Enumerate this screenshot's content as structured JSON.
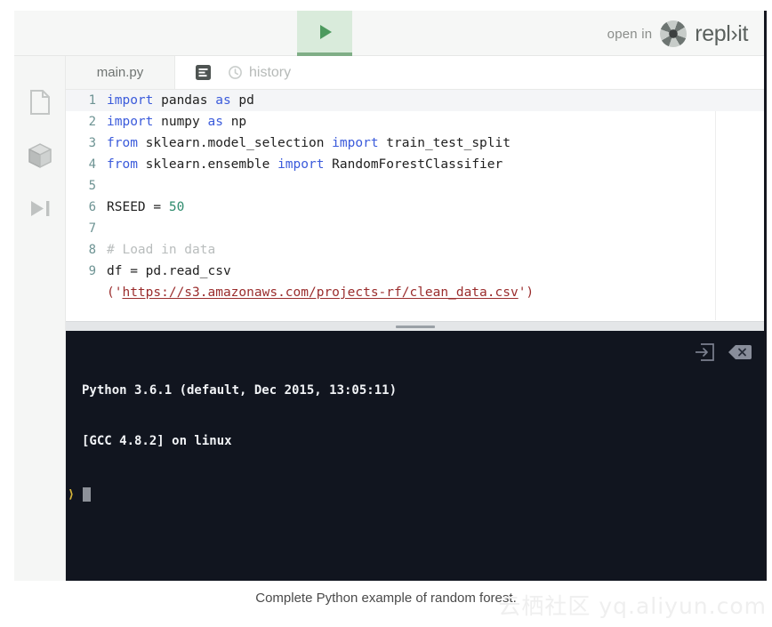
{
  "header": {
    "run_button_icon": "play-icon",
    "open_in_label": "open in",
    "repl_wordmark": "repl›it"
  },
  "rail": {
    "items": [
      {
        "icon": "file-icon",
        "name": "files"
      },
      {
        "icon": "package-box-icon",
        "name": "packages"
      },
      {
        "icon": "play-to-end-icon",
        "name": "debugger"
      }
    ]
  },
  "editor": {
    "tab_label": "main.py",
    "format_icon": "document-lines-icon",
    "history_icon": "clock-rewind-icon",
    "history_label": "history",
    "lines": [
      {
        "n": "1",
        "tokens": [
          {
            "t": "import",
            "c": "kw"
          },
          {
            "t": " pandas ",
            "c": ""
          },
          {
            "t": "as",
            "c": "kw"
          },
          {
            "t": " pd",
            "c": ""
          }
        ]
      },
      {
        "n": "2",
        "tokens": [
          {
            "t": "import",
            "c": "kw"
          },
          {
            "t": " numpy ",
            "c": ""
          },
          {
            "t": "as",
            "c": "kw"
          },
          {
            "t": " np",
            "c": ""
          }
        ]
      },
      {
        "n": "3",
        "tokens": [
          {
            "t": "from",
            "c": "kw"
          },
          {
            "t": " sklearn.model_selection ",
            "c": ""
          },
          {
            "t": "import",
            "c": "kw"
          },
          {
            "t": " train_test_split",
            "c": ""
          }
        ]
      },
      {
        "n": "4",
        "tokens": [
          {
            "t": "from",
            "c": "kw"
          },
          {
            "t": " sklearn.ensemble ",
            "c": ""
          },
          {
            "t": "import",
            "c": "kw"
          },
          {
            "t": " RandomForestClassifier",
            "c": ""
          }
        ]
      },
      {
        "n": "5",
        "tokens": []
      },
      {
        "n": "6",
        "tokens": [
          {
            "t": "RSEED = ",
            "c": ""
          },
          {
            "t": "50",
            "c": "num"
          }
        ]
      },
      {
        "n": "7",
        "tokens": []
      },
      {
        "n": "8",
        "tokens": [
          {
            "t": "# Load in data",
            "c": "com"
          }
        ]
      },
      {
        "n": "9",
        "tokens": [
          {
            "t": "df = pd.read_csv",
            "c": ""
          }
        ]
      },
      {
        "n": "",
        "tokens": [
          {
            "t": "('",
            "c": "str"
          },
          {
            "t": "https://s3.amazonaws.com/projects-rf/clean_data.csv",
            "c": "str-url"
          },
          {
            "t": "')",
            "c": "str"
          }
        ]
      }
    ]
  },
  "console": {
    "tools": [
      {
        "icon": "open-in-pane-icon",
        "name": "expand-console"
      },
      {
        "icon": "backspace-clear-icon",
        "name": "clear-console"
      }
    ],
    "output_line_1": "Python 3.6.1 (default, Dec 2015, 13:05:11)",
    "output_line_2": "[GCC 4.8.2] on linux",
    "prompt_symbol": "⟩",
    "input_value": ""
  },
  "caption": {
    "text": "Complete Python example of random forest."
  },
  "watermark": {
    "text": "云栖社区 yq.aliyun.com"
  },
  "colors": {
    "run_tab_bg": "#d9ebdb",
    "run_tab_accent": "#7fae86",
    "console_bg": "#11151f",
    "keyword": "#3b5bdb",
    "number": "#2e8b6d",
    "comment": "#b9bdbd",
    "string": "#9a2c2c",
    "line_number": "#6d9393"
  }
}
